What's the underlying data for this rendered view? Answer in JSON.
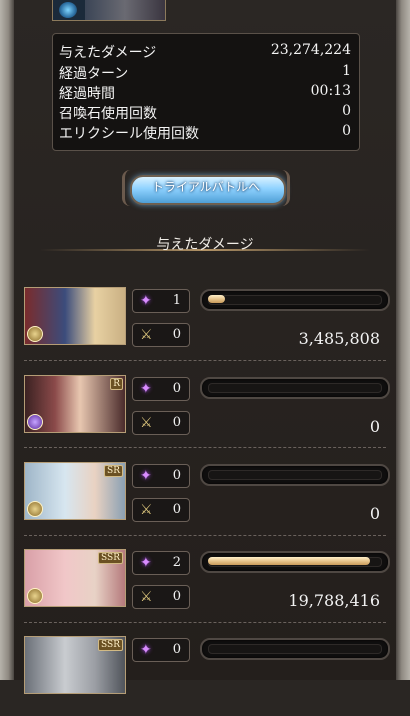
{
  "summary": {
    "stats": [
      {
        "label": "与えたダメージ",
        "value": "23,274,224"
      },
      {
        "label": "経過ターン",
        "value": "1"
      },
      {
        "label": "経過時間",
        "value": "00:13"
      },
      {
        "label": "召喚石使用回数",
        "value": "0"
      },
      {
        "label": "エリクシール使用回数",
        "value": "0"
      }
    ]
  },
  "trial_button": {
    "label": "トライアルバトルへ"
  },
  "section": {
    "title": "与えたダメージ"
  },
  "characters": [
    {
      "rarity": "",
      "element": "light",
      "special_count": "1",
      "attack_count": "0",
      "damage": "3,485,808",
      "bar_fraction": 0.1
    },
    {
      "rarity": "R",
      "element": "dark",
      "special_count": "0",
      "attack_count": "0",
      "damage": "0",
      "bar_fraction": 0
    },
    {
      "rarity": "SR",
      "element": "light",
      "special_count": "0",
      "attack_count": "0",
      "damage": "0",
      "bar_fraction": 0
    },
    {
      "rarity": "SSR",
      "element": "light",
      "special_count": "2",
      "attack_count": "0",
      "damage": "19,788,416",
      "bar_fraction": 0.95
    },
    {
      "rarity": "SSR",
      "element": "light",
      "special_count": "0",
      "attack_count": "",
      "damage": "",
      "bar_fraction": 0
    }
  ],
  "icons": {
    "special": "star-burst-icon",
    "attack": "crossed-swords-icon"
  },
  "colors": {
    "bar_fill": "#e7c58d",
    "special_icon": "#d98cff",
    "attack_icon": "#d8c27a"
  }
}
